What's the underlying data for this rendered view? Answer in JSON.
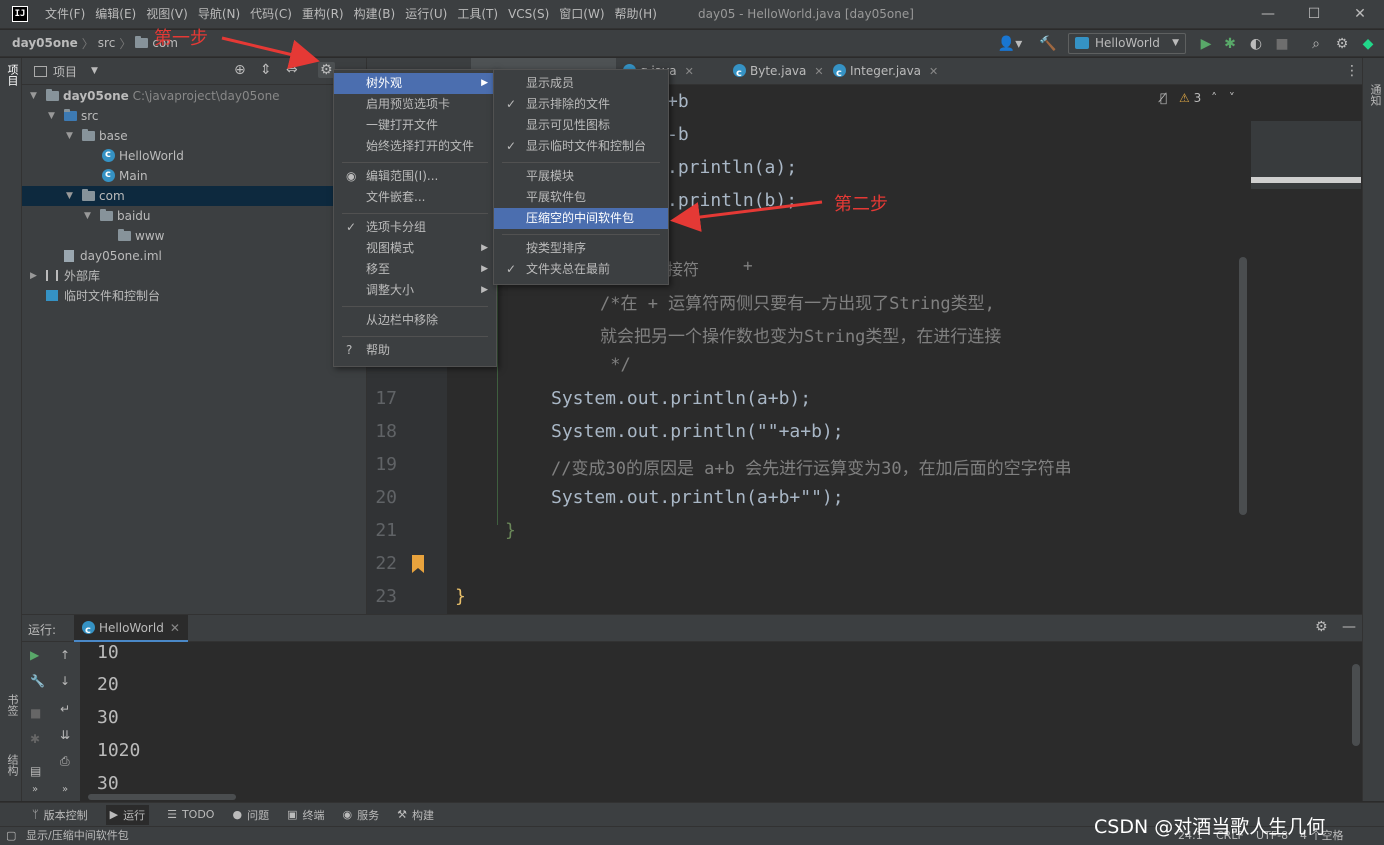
{
  "app": {
    "logo": "IJ",
    "window_title": "day05 - HelloWorld.java [day05one]",
    "menu": [
      "文件(F)",
      "编辑(E)",
      "视图(V)",
      "导航(N)",
      "代码(C)",
      "重构(R)",
      "构建(B)",
      "运行(U)",
      "工具(T)",
      "VCS(S)",
      "窗口(W)",
      "帮助(H)"
    ]
  },
  "breadcrumb": [
    "day05one",
    "src",
    "com"
  ],
  "toolbar": {
    "run_config": "HelloWorld"
  },
  "left_strip": {
    "project_label": "项目",
    "bookmarks_label": "书签",
    "structure_label": "结构"
  },
  "right_strip": {
    "notifications_label": "通知"
  },
  "project_panel": {
    "title": "项目",
    "root_name": "day05one",
    "root_path": "C:\\javaproject\\day05one",
    "items": {
      "src": "src",
      "base": "base",
      "helloworld": "HelloWorld",
      "main": "Main",
      "com": "com",
      "baidu": "baidu",
      "www": "www",
      "iml": "day05one.iml",
      "external_libs": "外部库",
      "scratches": "临时文件和控制台"
    }
  },
  "tabs": [
    "g.java",
    "Byte.java",
    "Integer.java"
  ],
  "editor": {
    "inspection_count": "3",
    "lines": [
      {
        "num": "17",
        "text": "System.out.println(a+b);"
      },
      {
        "num": "18",
        "text": "System.out.println(\"\"+a+b);"
      },
      {
        "num": "19",
        "text": "//变成30的原因是 a+b 会先进行运算变为30，在加后面的空字符串"
      },
      {
        "num": "20",
        "text": "System.out.println(a+b+\"\");"
      },
      {
        "num": "21",
        "text": "}"
      },
      {
        "num": "22",
        "text": ""
      },
      {
        "num": "23",
        "text": "}"
      }
    ],
    "partial": {
      "l1": "+b",
      "l2": "-b",
      "l3": ".println(a);",
      "l4": ".println(b);",
      "l5": "接符",
      "l5b": "+",
      "c1": "/*在 + 运算符两侧只要有一方出现了String类型,",
      "c2": "就会把另一个操作数也变为String类型，在进行连接",
      "c3": " */"
    }
  },
  "context_menu": {
    "items": [
      "树外观",
      "启用预览选项卡",
      "一键打开文件",
      "始终选择打开的文件",
      "编辑范围(I)...",
      "文件嵌套...",
      "选项卡分组",
      "视图模式",
      "移至",
      "调整大小",
      "从边栏中移除",
      "帮助"
    ]
  },
  "submenu": {
    "items": [
      "显示成员",
      "显示排除的文件",
      "显示可见性图标",
      "显示临时文件和控制台",
      "平展模块",
      "平展软件包",
      "压缩空的中间软件包",
      "按类型排序",
      "文件夹总在最前"
    ]
  },
  "annotations": {
    "step1": "第一步",
    "step2": "第二步"
  },
  "run_panel": {
    "label": "运行:",
    "tab": "HelloWorld",
    "output": [
      "10",
      "20",
      "30",
      "1020",
      "30"
    ]
  },
  "bottom_tools": [
    "版本控制",
    "运行",
    "TODO",
    "问题",
    "终端",
    "服务",
    "构建"
  ],
  "status": {
    "message": "显示/压缩中间软件包",
    "position": "24:1",
    "line_sep": "CRLF",
    "encoding": "UTF-8",
    "indent": "4 个空格"
  },
  "watermark": "CSDN @对酒当歌人生几何"
}
